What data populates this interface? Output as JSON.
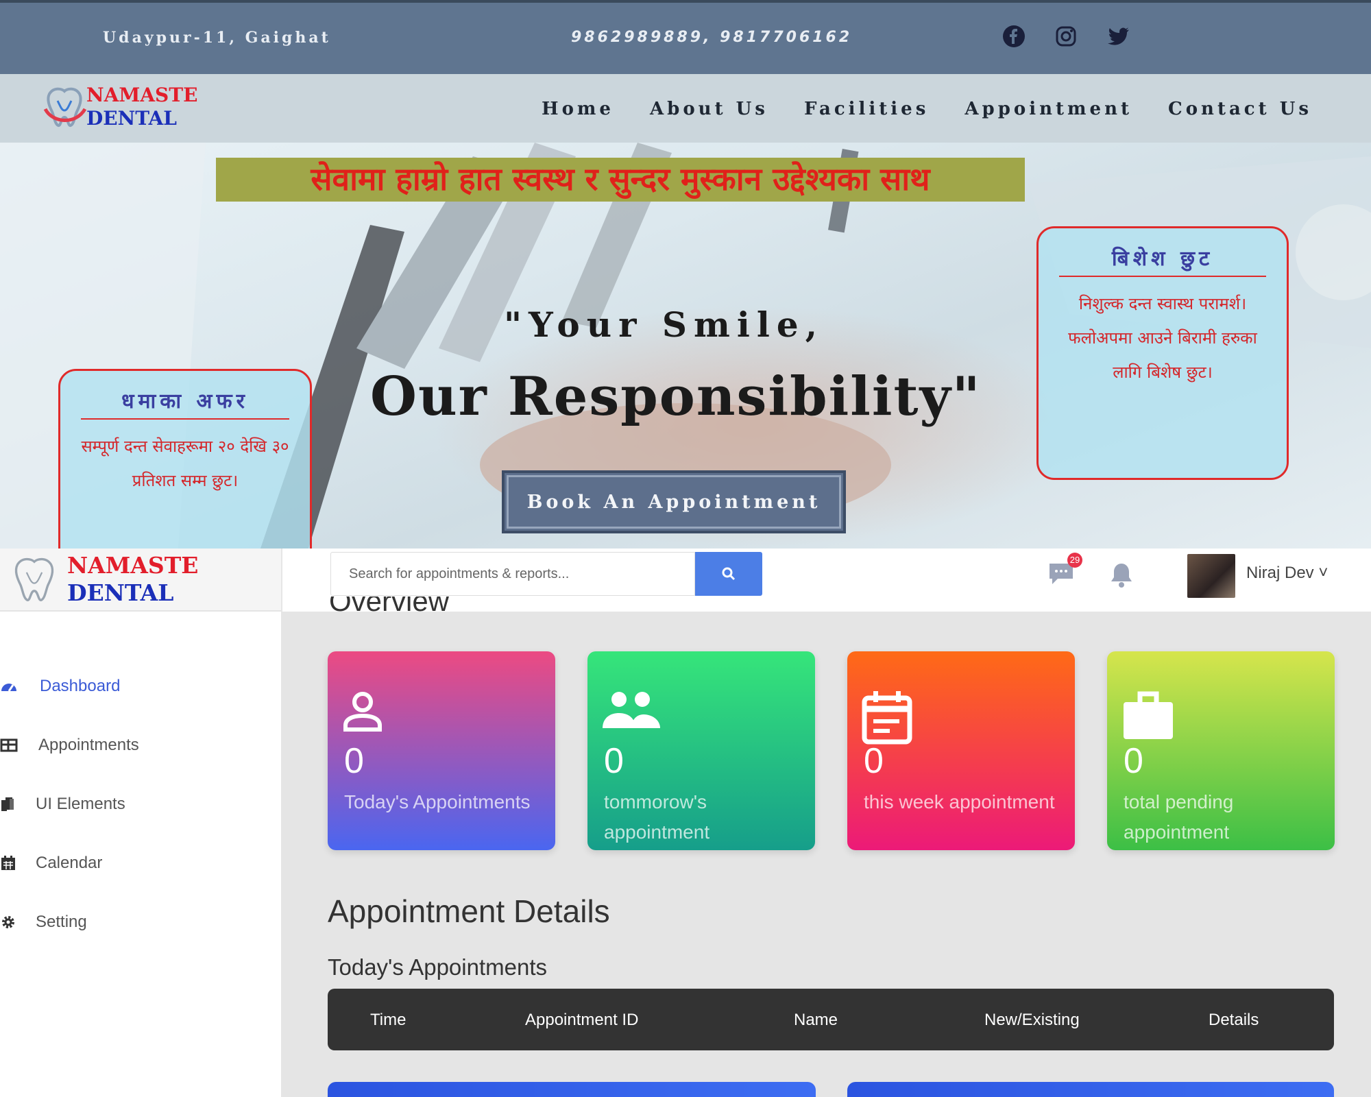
{
  "website": {
    "topbar": {
      "address": "Udaypur-11, Gaighat",
      "phone": "9862989889, 9817706162",
      "social": [
        "facebook-icon",
        "instagram-icon",
        "twitter-icon"
      ]
    },
    "logo": {
      "line1": "NAMASTE",
      "line2": "DENTAL"
    },
    "nav": [
      "Home",
      "About Us",
      "Facilities",
      "Appointment",
      "Contact Us"
    ],
    "hero": {
      "banner": "सेवामा हाम्रो हात स्वस्थ र सुन्दर मुस्कान उद्देश्यका साथ",
      "quote_line1": "\"Your Smile,",
      "quote_line2": "Our Responsibility\"",
      "cta": "Book An Appointment",
      "offer_left": {
        "title": "धमाका अफर",
        "body": "सम्पूर्ण दन्त सेवाहरूमा २० देखि ३० प्रतिशत सम्म छुट।"
      },
      "offer_right": {
        "title": "बिशेश छुट",
        "body": "निशुल्क दन्त स्वास्थ परामर्श। फलोअपमा आउने बिरामी हरुका लागि बिशेष छुट।"
      }
    }
  },
  "dashboard": {
    "logo": {
      "line1": "NAMASTE",
      "line2": "DENTAL"
    },
    "search": {
      "placeholder": "Search for appointments & reports..."
    },
    "messages_badge": "29",
    "user": {
      "name": "Niraj Dev ˅"
    },
    "sidebar": [
      {
        "label": "Dashboard",
        "icon": "dashboard-icon",
        "active": true
      },
      {
        "label": "Appointments",
        "icon": "table-icon"
      },
      {
        "label": "UI Elements",
        "icon": "files-icon"
      },
      {
        "label": "Calendar",
        "icon": "calendar-icon"
      },
      {
        "label": "Setting",
        "icon": "gear-icon"
      }
    ],
    "overview_title": "Overview",
    "cards": [
      {
        "value": "0",
        "label": "Today's Appointments",
        "icon": "user-icon",
        "gradient": [
          "#ec4a82",
          "#4a66f0"
        ]
      },
      {
        "value": "0",
        "label": "tommorow's appointment",
        "icon": "users-icon",
        "gradient": [
          "#36e57a",
          "#169e8a"
        ]
      },
      {
        "value": "0",
        "label": "this week appointment",
        "icon": "calendar-icon",
        "gradient": [
          "#ff6a16",
          "#ec1a78"
        ]
      },
      {
        "value": "0",
        "label": "total pending appointment",
        "icon": "briefcase-icon",
        "gradient": [
          "#d6e54c",
          "#3cbf46"
        ]
      }
    ],
    "section_title": "Appointment Details",
    "subsection_title": "Today's Appointments",
    "table_headers": [
      "Time",
      "Appointment ID",
      "Name",
      "New/Existing",
      "Details"
    ]
  }
}
